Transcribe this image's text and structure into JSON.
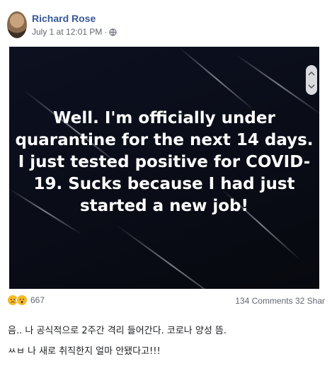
{
  "post": {
    "author": "Richard Rose",
    "timestamp": "July 1 at 12:01 PM",
    "separator": "·",
    "privacy_icon": "globe-icon",
    "image_text_lines": [
      "Well. I'm officially under",
      "quarantine for the next 14 days.",
      "I just tested positive for COVID-",
      "19. Sucks because I had just",
      "started a new job!"
    ],
    "reaction_icons": [
      "sad-emoji-icon",
      "wow-emoji-icon"
    ],
    "reaction_count": "667",
    "comments": "134 Comments",
    "shares": "32 Shar"
  },
  "caption": {
    "line1": "음.. 나 공식적으로 2주간 격리 들어간다. 코로나 양성 뜸.",
    "line2": "ㅆㅂ 나 새로 취직한지 얼마 안됐다고!!!"
  }
}
